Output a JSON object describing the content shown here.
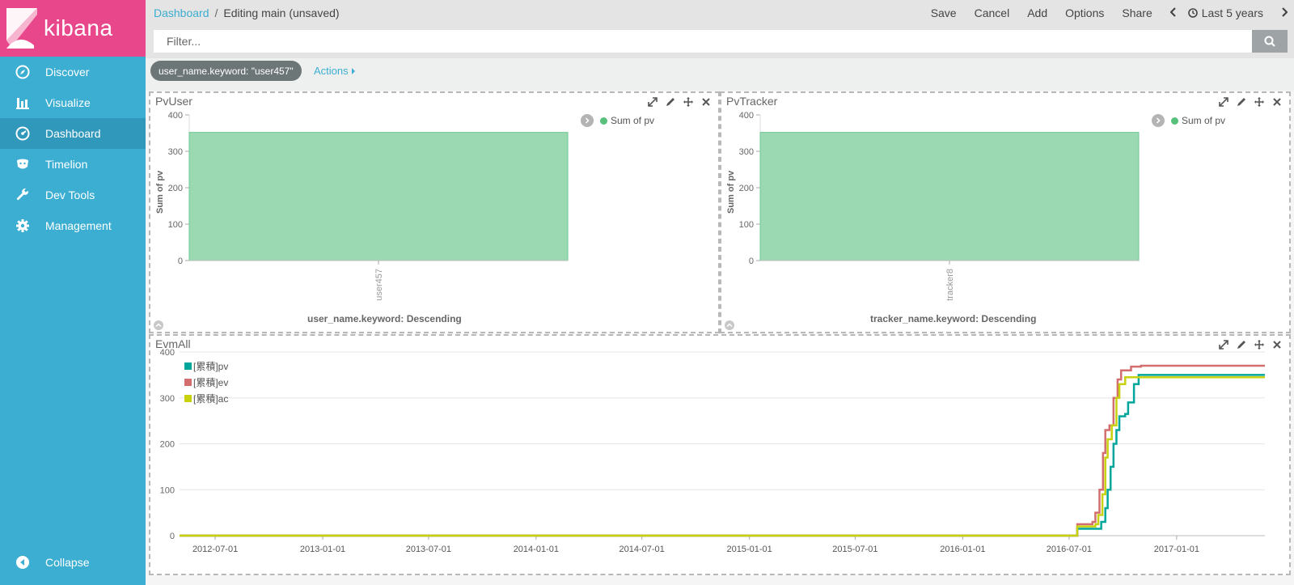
{
  "app": {
    "name": "kibana"
  },
  "sidebar": {
    "items": [
      {
        "label": "Discover",
        "icon": "compass-icon"
      },
      {
        "label": "Visualize",
        "icon": "bar-chart-icon"
      },
      {
        "label": "Dashboard",
        "icon": "dashboard-icon",
        "active": true
      },
      {
        "label": "Timelion",
        "icon": "timelion-icon"
      },
      {
        "label": "Dev Tools",
        "icon": "wrench-icon"
      },
      {
        "label": "Management",
        "icon": "gear-icon"
      }
    ],
    "collapse_label": "Collapse"
  },
  "header": {
    "breadcrumb_root": "Dashboard",
    "breadcrumb_sep": "/",
    "breadcrumb_current": "Editing main (unsaved)",
    "actions": [
      "Save",
      "Cancel",
      "Add",
      "Options",
      "Share"
    ],
    "time_label": "Last 5 years"
  },
  "filter": {
    "placeholder": "Filter..."
  },
  "pill": {
    "label": "user_name.keyword: \"user457\""
  },
  "actions_label": "Actions",
  "colors": {
    "sidebar": "#3caed2",
    "logo_bg": "#e8488b",
    "active_nav": "#3098bb",
    "bar_fill": "#9ad9b1",
    "bar_stroke": "#6fc996",
    "legend_green": "#57c17b",
    "pv": "#00a69b",
    "ev": "#d36e6e",
    "ac": "#c7d10e"
  },
  "chart_data": [
    {
      "type": "bar",
      "panel_title": "PvUser",
      "categories": [
        "user457"
      ],
      "series": [
        {
          "name": "Sum of pv",
          "values": [
            352
          ]
        }
      ],
      "xlabel": "user_name.keyword: Descending",
      "ylabel": "Sum of pv",
      "yticks": [
        0,
        100,
        200,
        300,
        400
      ],
      "ylim": [
        0,
        400
      ],
      "legend": "top-right"
    },
    {
      "type": "bar",
      "panel_title": "PvTracker",
      "categories": [
        "tracker8"
      ],
      "series": [
        {
          "name": "Sum of pv",
          "values": [
            352
          ]
        }
      ],
      "xlabel": "tracker_name.keyword: Descending",
      "ylabel": "Sum of pv",
      "yticks": [
        0,
        100,
        200,
        300,
        400
      ],
      "ylim": [
        0,
        400
      ],
      "legend": "top-right"
    },
    {
      "type": "line",
      "panel_title": "EvmAll",
      "xticks": [
        "2012-07-01",
        "2013-01-01",
        "2013-07-01",
        "2014-01-01",
        "2014-07-01",
        "2015-01-01",
        "2015-07-01",
        "2016-01-01",
        "2016-07-01",
        "2017-01-01"
      ],
      "xlim": [
        "2012-05-01",
        "2017-06-01"
      ],
      "yticks": [
        0,
        100,
        200,
        300,
        400
      ],
      "ylim": [
        0,
        400
      ],
      "legend": "top-left",
      "series": [
        {
          "name": "[累積]pv",
          "color": "#00a69b",
          "points": [
            [
              "2012-05-01",
              0
            ],
            [
              "2016-07-01",
              0
            ],
            [
              "2016-07-15",
              15
            ],
            [
              "2016-08-20",
              15
            ],
            [
              "2016-08-25",
              30
            ],
            [
              "2016-09-01",
              60
            ],
            [
              "2016-09-05",
              100
            ],
            [
              "2016-09-10",
              150
            ],
            [
              "2016-09-15",
              200
            ],
            [
              "2016-09-20",
              230
            ],
            [
              "2016-09-25",
              260
            ],
            [
              "2016-10-05",
              265
            ],
            [
              "2016-10-10",
              290
            ],
            [
              "2016-10-20",
              330
            ],
            [
              "2016-10-28",
              350
            ],
            [
              "2017-06-01",
              350
            ]
          ]
        },
        {
          "name": "[累積]ev",
          "color": "#d36e6e",
          "points": [
            [
              "2012-05-01",
              0
            ],
            [
              "2016-07-01",
              0
            ],
            [
              "2016-07-15",
              25
            ],
            [
              "2016-08-10",
              30
            ],
            [
              "2016-08-15",
              50
            ],
            [
              "2016-08-22",
              100
            ],
            [
              "2016-08-28",
              180
            ],
            [
              "2016-09-01",
              230
            ],
            [
              "2016-09-08",
              240
            ],
            [
              "2016-09-15",
              300
            ],
            [
              "2016-09-22",
              340
            ],
            [
              "2016-09-28",
              360
            ],
            [
              "2016-10-15",
              368
            ],
            [
              "2016-11-01",
              370
            ],
            [
              "2017-06-01",
              370
            ]
          ]
        },
        {
          "name": "[累積]ac",
          "color": "#c7d10e",
          "points": [
            [
              "2012-05-01",
              0
            ],
            [
              "2016-07-01",
              0
            ],
            [
              "2016-07-15",
              20
            ],
            [
              "2016-08-15",
              25
            ],
            [
              "2016-08-20",
              45
            ],
            [
              "2016-08-27",
              90
            ],
            [
              "2016-09-01",
              170
            ],
            [
              "2016-09-05",
              210
            ],
            [
              "2016-09-12",
              240
            ],
            [
              "2016-09-20",
              300
            ],
            [
              "2016-09-25",
              330
            ],
            [
              "2016-10-05",
              345
            ],
            [
              "2017-06-01",
              345
            ]
          ]
        }
      ]
    }
  ]
}
